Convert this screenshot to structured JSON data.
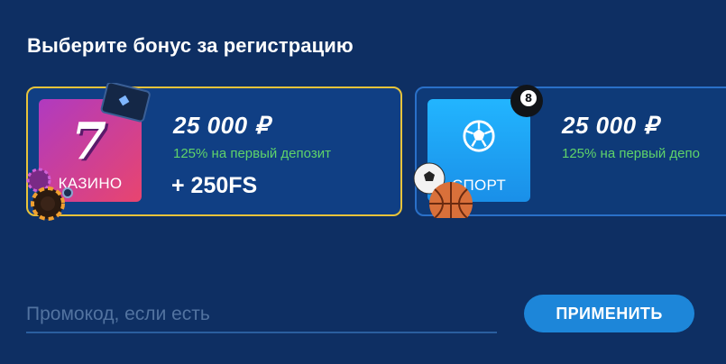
{
  "title": "Выберите бонус за регистрацию",
  "bonuses": [
    {
      "id": "casino",
      "tile_label": "КАЗИНО",
      "amount": "25 000 ₽",
      "description": "125% на первый депозит",
      "extra": "+ 250FS",
      "selected": true,
      "border_color": "#e8c33a",
      "icon": "seven-icon"
    },
    {
      "id": "sport",
      "tile_label": "СПОРТ",
      "amount": "25 000 ₽",
      "description": "125% на первый депо",
      "selected": false,
      "border_color": "#2a70c8",
      "icon": "soccer-ball-icon"
    }
  ],
  "promo": {
    "placeholder": "Промокод, если есть",
    "value": "",
    "apply_label": "ПРИМЕНИТЬ"
  },
  "colors": {
    "background": "#0e2f63",
    "accent_green": "#5fd36a",
    "button": "#1d86d9"
  }
}
